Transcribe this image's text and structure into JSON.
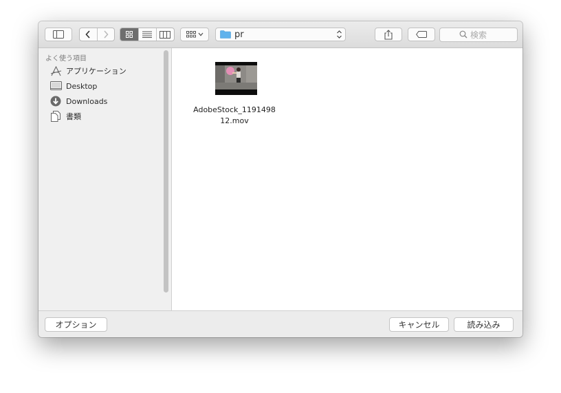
{
  "toolbar": {
    "path": {
      "folder_name": "pr",
      "folder_color": "#5fb2ec"
    },
    "search": {
      "placeholder": "検索"
    }
  },
  "sidebar": {
    "header": "よく使う項目",
    "items": [
      {
        "label": "アプリケーション",
        "icon": "applications-icon"
      },
      {
        "label": "Desktop",
        "icon": "desktop-icon"
      },
      {
        "label": "Downloads",
        "icon": "downloads-icon"
      },
      {
        "label": "書類",
        "icon": "documents-icon"
      }
    ]
  },
  "files": [
    {
      "name": "AdobeStock_119149812.mov",
      "kind": "video-thumbnail"
    }
  ],
  "footer": {
    "options_label": "オプション",
    "cancel_label": "キャンセル",
    "open_label": "読み込み"
  }
}
